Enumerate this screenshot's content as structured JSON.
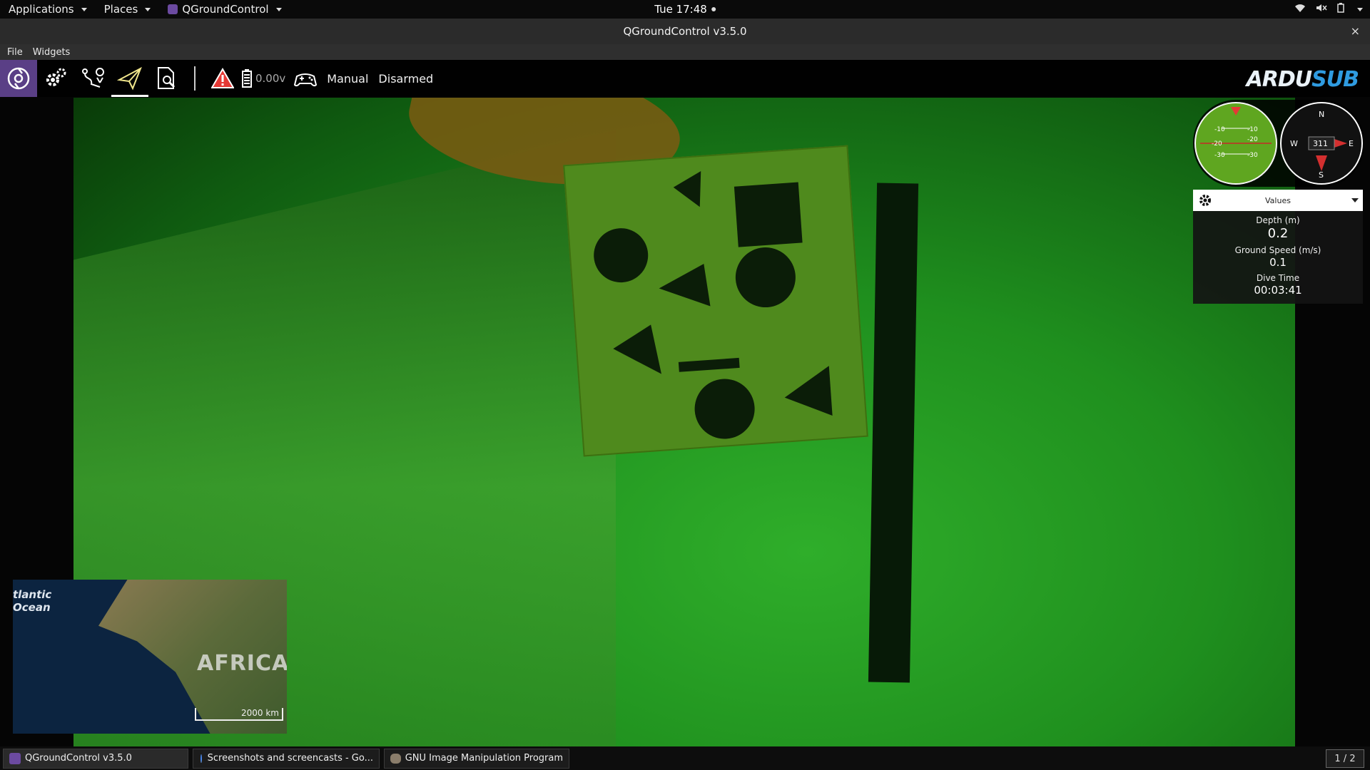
{
  "topbar": {
    "applications": "Applications",
    "places": "Places",
    "app_name": "QGroundControl",
    "clock": "Tue 17:48"
  },
  "window": {
    "title": "QGroundControl v3.5.0",
    "close": "×"
  },
  "menubar": {
    "file": "File",
    "widgets": "Widgets"
  },
  "toolbar": {
    "voltage": "0.00v",
    "flight_mode": "Manual",
    "arm_state": "Disarmed",
    "logo_part1": "ARDU",
    "logo_part2": "SUB"
  },
  "instruments": {
    "pitch_labels": [
      "-10",
      "-10",
      "-20",
      "-20",
      "-30",
      "-30"
    ],
    "compass": {
      "north": "N",
      "south": "S",
      "east": "E",
      "west": "W",
      "heading": "311"
    }
  },
  "values_panel": {
    "selector": "Values",
    "depth_label": "Depth (m)",
    "depth_value": "0.2",
    "speed_label": "Ground Speed (m/s)",
    "speed_value": "0.1",
    "dive_label": "Dive Time",
    "dive_value": "00:03:41"
  },
  "minimap": {
    "ocean_line1": "tlantic",
    "ocean_line2": "Ocean",
    "continent": "AFRICA",
    "scale": "2000 km"
  },
  "taskbar": {
    "items": [
      {
        "label": "QGroundControl v3.5.0"
      },
      {
        "label": "Screenshots and screencasts - Go..."
      },
      {
        "label": "GNU Image Manipulation Program"
      }
    ],
    "pager": "1 / 2"
  }
}
